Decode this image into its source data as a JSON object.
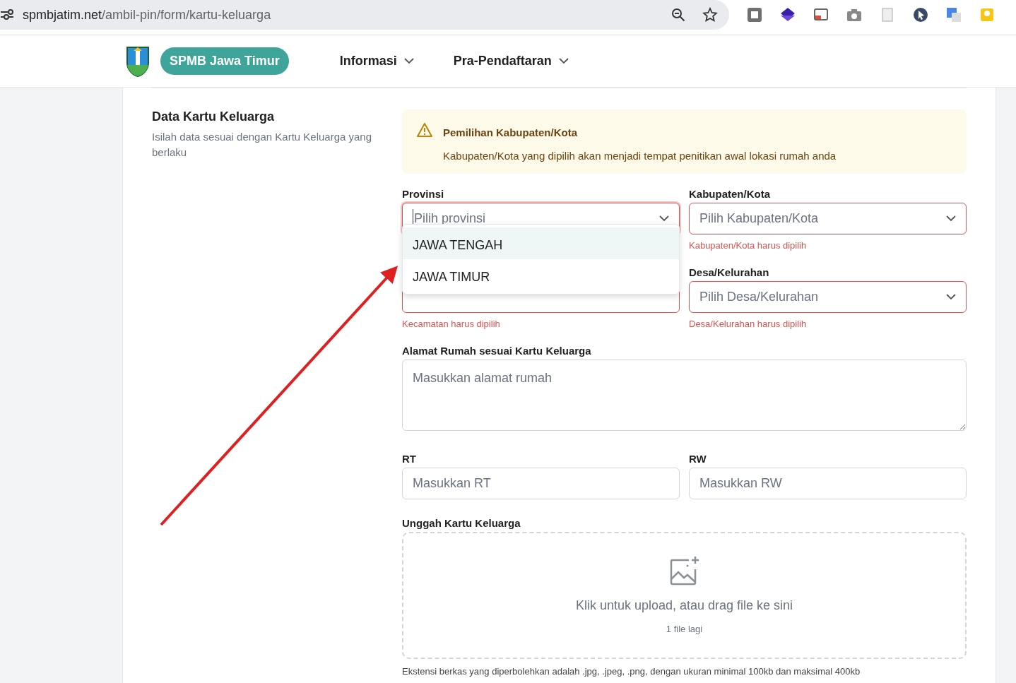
{
  "browser": {
    "url_host": "spmbjatim.net",
    "url_path": "/ambil-pin/form/kartu-keluarga"
  },
  "navbar": {
    "brand": "SPMB Jawa Timur",
    "menus": [
      {
        "label": "Informasi"
      },
      {
        "label": "Pra-Pendaftaran"
      }
    ]
  },
  "section": {
    "title": "Data Kartu Keluarga",
    "description": "Isilah data sesuai dengan Kartu Keluarga yang berlaku"
  },
  "alert": {
    "title": "Pemilihan Kabupaten/Kota",
    "message": "Kabupaten/Kota yang dipilih akan menjadi tempat penitikan awal lokasi rumah anda"
  },
  "provinsi": {
    "label": "Provinsi",
    "placeholder": "Pilih provinsi",
    "focused": true,
    "invalid": true,
    "options": [
      {
        "label": "JAWA TENGAH",
        "selected": true
      },
      {
        "label": "JAWA TIMUR",
        "selected": false
      }
    ]
  },
  "kabupaten": {
    "label": "Kabupaten/Kota",
    "placeholder": "Pilih Kabupaten/Kota",
    "invalid": true,
    "error": "Kabupaten/Kota harus dipilih"
  },
  "kecamatan": {
    "invalid": true,
    "error": "Kecamatan harus dipilih"
  },
  "desa": {
    "label": "Desa/Kelurahan",
    "placeholder": "Pilih Desa/Kelurahan",
    "invalid": true,
    "error": "Desa/Kelurahan harus dipilih"
  },
  "alamat": {
    "label": "Alamat Rumah sesuai Kartu Keluarga",
    "placeholder": "Masukkan alamat rumah"
  },
  "rt": {
    "label": "RT",
    "placeholder": "Masukkan RT"
  },
  "rw": {
    "label": "RW",
    "placeholder": "Masukkan RW"
  },
  "upload": {
    "label": "Unggah Kartu Keluarga",
    "prompt": "Klik untuk upload, atau drag file ke sini",
    "count": "1 file lagi",
    "note": "Ekstensi berkas yang diperbolehkan adalah .jpg, .jpeg, .png, dengan ukuran minimal 100kb dan maksimal 400kb"
  }
}
